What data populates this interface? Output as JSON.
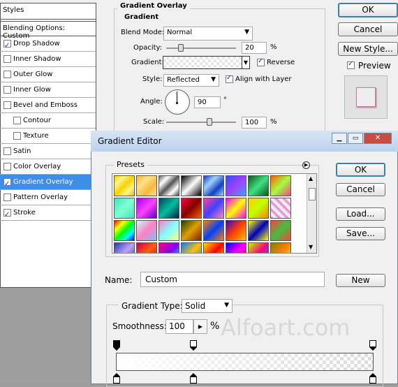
{
  "layer_style": {
    "styles_label": "Styles",
    "blending_options": "Blending Options: Custom",
    "items": [
      {
        "label": "Drop Shadow",
        "checked": true,
        "indent": false,
        "active": false
      },
      {
        "label": "Inner Shadow",
        "checked": false,
        "indent": false,
        "active": false
      },
      {
        "label": "Outer Glow",
        "checked": false,
        "indent": false,
        "active": false
      },
      {
        "label": "Inner Glow",
        "checked": false,
        "indent": false,
        "active": false
      },
      {
        "label": "Bevel and Emboss",
        "checked": false,
        "indent": false,
        "active": false
      },
      {
        "label": "Contour",
        "checked": false,
        "indent": true,
        "active": false
      },
      {
        "label": "Texture",
        "checked": false,
        "indent": true,
        "active": false
      },
      {
        "label": "Satin",
        "checked": false,
        "indent": false,
        "active": false
      },
      {
        "label": "Color Overlay",
        "checked": false,
        "indent": false,
        "active": false
      },
      {
        "label": "Gradient Overlay",
        "checked": true,
        "indent": false,
        "active": true
      },
      {
        "label": "Pattern Overlay",
        "checked": false,
        "indent": false,
        "active": false
      },
      {
        "label": "Stroke",
        "checked": true,
        "indent": false,
        "active": false
      }
    ],
    "section_title": "Gradient Overlay",
    "subsection_title": "Gradient",
    "blend_mode_label": "Blend Mode:",
    "blend_mode_value": "Normal",
    "opacity_label": "Opacity:",
    "opacity_value": "20",
    "opacity_unit": "%",
    "gradient_label": "Gradient:",
    "reverse_label": "Reverse",
    "style_label": "Style:",
    "style_value": "Reflected",
    "align_label": "Align with Layer",
    "angle_label": "Angle:",
    "angle_value": "90",
    "angle_unit": "°",
    "scale_label": "Scale:",
    "scale_value": "100",
    "scale_unit": "%",
    "ok_label": "OK",
    "cancel_label": "Cancel",
    "new_style_label": "New Style...",
    "preview_label": "Preview"
  },
  "gradient_editor": {
    "title": "Gradient Editor",
    "presets_label": "Presets",
    "ok_label": "OK",
    "cancel_label": "Cancel",
    "load_label": "Load...",
    "save_label": "Save...",
    "name_label": "Name:",
    "name_value": "Custom",
    "new_label": "New",
    "gradient_type_label": "Gradient Type:",
    "gradient_type_value": "Solid",
    "smoothness_label": "Smoothness:",
    "smoothness_value": "100",
    "smoothness_unit": "%",
    "watermark": "Alfoart.com",
    "swatches": [
      "linear-gradient(135deg,#f5d400,#fff38a,#f5d400,#fff38a,#e8b800)",
      "linear-gradient(135deg,#f7b93a,#ffe08a,#f7b93a,#ffe08a)",
      "linear-gradient(135deg,#666,#fff,#555,#fff,#444)",
      "linear-gradient(135deg,#000,#fff,#000)",
      "linear-gradient(135deg,#1040c0,#9fd0ff,#1040c0,#9fd0ff)",
      "linear-gradient(135deg,#3050ff,#a040ff,#40a0ff)",
      "linear-gradient(135deg,#0a5a20,#40e080,#0a5a20)",
      "linear-gradient(135deg,#ff6000,#a0ff40,#ff4080)",
      "linear-gradient(135deg,#40e0c0,#80ffd0,#40e0c0)",
      "linear-gradient(135deg,#a000ff,#ff40ff,#6000c0)",
      "linear-gradient(135deg,#004060,#00c0a0,#002040)",
      "linear-gradient(135deg,#ff0040,#800000,#ff6000)",
      "linear-gradient(135deg,#ff40a0,#4040ff,#ff80c0)",
      "linear-gradient(135deg,#ff00ff,#ffff00,#ff00ff)",
      "linear-gradient(135deg,#ffd000,#c0ff00,#ff8000)",
      "repeating-linear-gradient(45deg,#ff60a0 0,#fff 4px,#c0c0ff 8px)",
      "linear-gradient(135deg,#ff0000,#ffff00,#00ff00,#00ffff,#0000ff)",
      "linear-gradient(135deg,#c0ffff,#ff80c0,#80c0ff)",
      "linear-gradient(135deg,#ff80c0,#80ffff,#ffff80)",
      "linear-gradient(135deg,#204000,#e0a000,#802000)",
      "linear-gradient(135deg,#ff8000,#0040ff,#ff8000)",
      "linear-gradient(135deg,#4000c0,#ff4000,#ffc000)",
      "linear-gradient(135deg,#ffff00,#0000c0,#ffff00)",
      "linear-gradient(135deg,#ff4040,#40c040,#ff4040)",
      "linear-gradient(135deg,#2040a0,#c0a0ff,#2040a0)",
      "linear-gradient(135deg,#c00060,#ff6000,#c00060)",
      "linear-gradient(135deg,#ff0080,#8000ff,#00ffff)",
      "linear-gradient(135deg,#0080ff,#ffc000,#0080ff)",
      "linear-gradient(135deg,#ffe000,#ff0000,#ffe000)",
      "linear-gradient(135deg,#0000ff,#ff00ff,#ff0000)",
      "linear-gradient(135deg,#c0ff00,#ff0080,#0080ff)",
      "linear-gradient(135deg,#808000,#ff8000,#ffff00)"
    ]
  }
}
